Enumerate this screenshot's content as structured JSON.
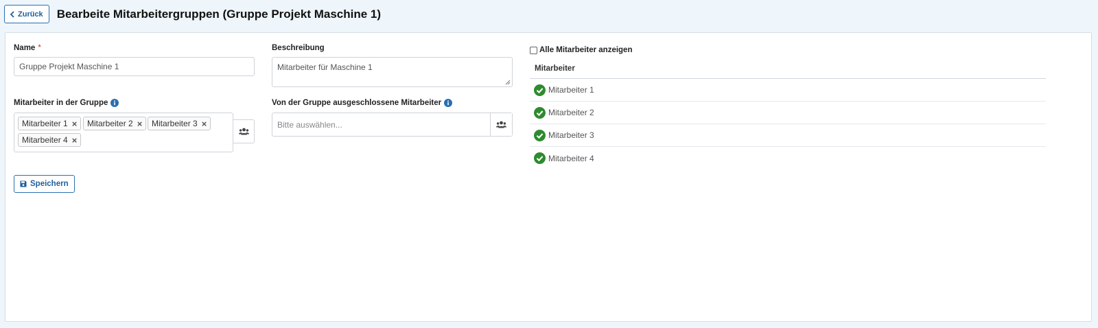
{
  "header": {
    "back_label": "Zurück",
    "title": "Bearbeite Mitarbeitergruppen (Gruppe Projekt Maschine 1)"
  },
  "form": {
    "name": {
      "label": "Name",
      "required_marker": "*",
      "value": "Gruppe Projekt Maschine 1"
    },
    "description": {
      "label": "Beschreibung",
      "value": "Mitarbeiter für Maschine 1"
    },
    "members": {
      "label": "Mitarbeiter in der Gruppe",
      "tags": [
        "Mitarbeiter 1",
        "Mitarbeiter 2",
        "Mitarbeiter 3",
        "Mitarbeiter 4"
      ],
      "remove_symbol": "×"
    },
    "excluded": {
      "label": "Von der Gruppe ausgeschlossene Mitarbeiter",
      "placeholder": "Bitte auswählen..."
    },
    "save_label": "Speichern"
  },
  "employee_panel": {
    "show_all_label": "Alle Mitarbeiter anzeigen",
    "show_all_checked": false,
    "column_header": "Mitarbeiter",
    "rows": [
      {
        "name": "Mitarbeiter 1",
        "status_icon": "check-circle-icon"
      },
      {
        "name": "Mitarbeiter 2",
        "status_icon": "check-circle-icon"
      },
      {
        "name": "Mitarbeiter 3",
        "status_icon": "check-circle-icon"
      },
      {
        "name": "Mitarbeiter 4",
        "status_icon": "check-circle-icon"
      }
    ]
  },
  "colors": {
    "accent": "#1f5e9e",
    "success": "#2e8b2e",
    "required": "#c9302c",
    "page_background": "#eef5fb"
  }
}
